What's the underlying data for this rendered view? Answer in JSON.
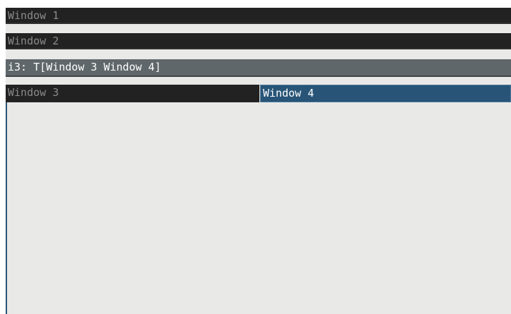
{
  "window_manager": {
    "containers": [
      {
        "label": "Window 1"
      },
      {
        "label": "Window 2"
      }
    ],
    "tabbed_container": {
      "title": "i3: T[Window 3 Window 4]",
      "tabs": [
        {
          "label": "Window 3",
          "focused": false
        },
        {
          "label": "Window 4",
          "focused": true
        }
      ]
    }
  },
  "colors": {
    "unfocused_bg": "#222222",
    "unfocused_text": "#8b8b8b",
    "focused_inactive_bg": "#5f676a",
    "focused_bg": "#285577",
    "focused_border": "#4c7899",
    "content_bg": "#e9e9e8"
  }
}
